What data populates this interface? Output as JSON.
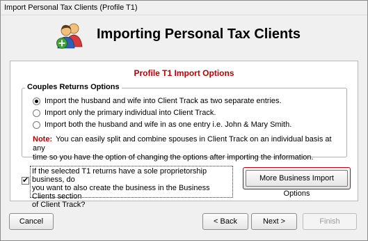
{
  "window": {
    "title": "Import Personal Tax Clients (Profile T1)"
  },
  "header": {
    "title": "Importing Personal Tax Clients",
    "icon": "people-plus-icon"
  },
  "options_panel": {
    "title": "Profile T1 Import Options",
    "group": {
      "legend": "Couples Returns Options",
      "options": [
        {
          "label": "Import the husband and wife into Client Track as two separate entries.",
          "selected": true
        },
        {
          "label": "Import only the primary individual into Client Track.",
          "selected": false
        },
        {
          "label": "Import both the husband and wife in as one entry  i.e. John & Mary Smith.",
          "selected": false
        }
      ],
      "note_label": "Note:",
      "note_line1": "You can easily split and combine spouses in Client Track on an individual basis at any",
      "note_line2": "time so you have the option of changing the options after importing the information."
    },
    "business_checkbox": {
      "checked": true,
      "line1": "If the selected T1 returns have a sole proprietorship business, do",
      "line2": "you want to also create the business in the Business Clients section",
      "line3": "of Client Track?"
    },
    "more_button": "More Business Import Options"
  },
  "footer": {
    "cancel": "Cancel",
    "back": "< Back",
    "next": "Next >",
    "finish": "Finish"
  }
}
